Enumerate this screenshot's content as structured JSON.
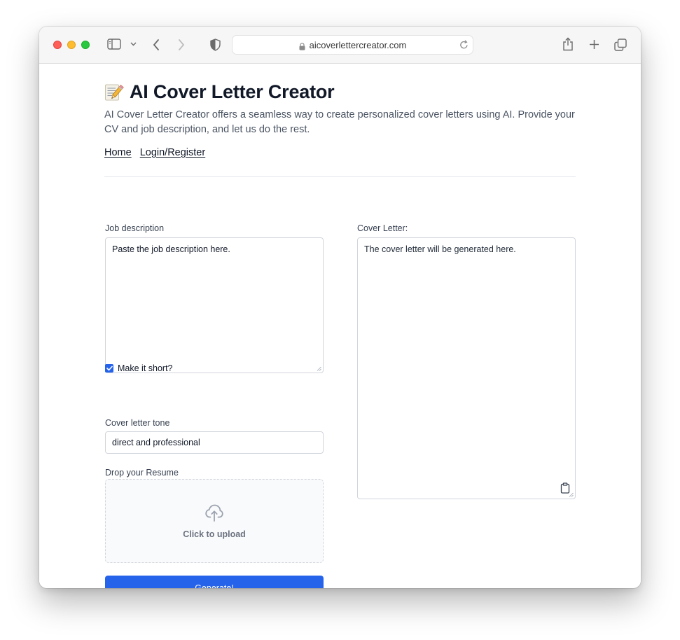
{
  "browser": {
    "url": "aicoverlettercreator.com"
  },
  "page": {
    "title_emoji": "📝",
    "title": "AI Cover Letter Creator",
    "intro": "AI Cover Letter Creator offers a seamless way to create personalized cover letters using AI. Provide your CV and job description, and let us do the rest."
  },
  "nav": {
    "home": "Home",
    "login": "Login/Register"
  },
  "form": {
    "job_label": "Job description",
    "job_placeholder": "Paste the job description here.",
    "short_label": "Make it short?",
    "short_checked": true,
    "tone_label": "Cover letter tone",
    "tone_value": "direct and professional",
    "resume_label": "Drop your Resume",
    "upload_hint": "Click to upload",
    "generate_label": "Generate!"
  },
  "output": {
    "label": "Cover Letter:",
    "placeholder": "The cover letter will be generated here."
  },
  "icons": {
    "sidebar": "sidebar-icon",
    "back": "chevron-left-icon",
    "forward": "chevron-right-icon",
    "privacy": "shield-icon",
    "lock": "lock-icon",
    "reload": "reload-icon",
    "share": "share-icon",
    "new_tab": "plus-icon",
    "tabs": "tabs-icon",
    "upload": "cloud-upload-icon",
    "copy": "clipboard-icon"
  },
  "colors": {
    "accent": "#2563eb",
    "heading": "#111827",
    "body_text": "#4b5563"
  }
}
